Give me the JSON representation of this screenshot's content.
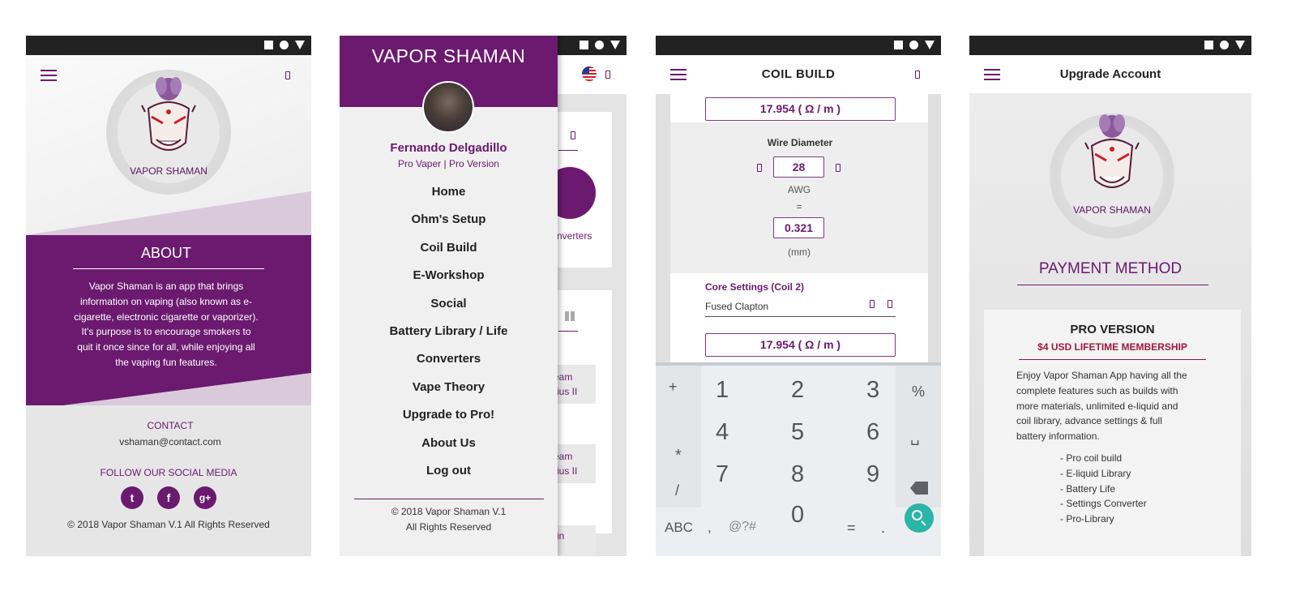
{
  "about_screen": {
    "logo_text": "VAPOR SHAMAN",
    "heading": "ABOUT",
    "body_lines": [
      "Vapor Shaman is an app that brings",
      "information on vaping (also known as e-",
      "cigarette, electronic cigarette or vaporizer).",
      "It's purpose is to encourage smokers to",
      "quit it once since for all, while enjoying all",
      "the vaping fun features."
    ],
    "contact_label": "CONTACT",
    "contact_email": "vshaman@contact.com",
    "social_label": "FOLLOW OUR SOCIAL MEDIA",
    "social": [
      "twitter-icon",
      "facebook-icon",
      "google-plus-icon"
    ],
    "social_glyphs": [
      "t",
      "f",
      "g+"
    ],
    "copyright": "© 2018 Vapor Shaman V.1  All Rights Reserved"
  },
  "menu_screen": {
    "app_name": "VAPOR SHAMAN",
    "user_name": "Fernando Delgadillo",
    "user_role": "Pro Vaper | Pro Version",
    "items": [
      "Home",
      "Ohm's Setup",
      "Coil Build",
      "E-Workshop",
      "Social",
      "Battery Library / Life",
      "Converters",
      "Vape Theory",
      "Upgrade to Pro!",
      "About Us",
      "Log out"
    ],
    "footer_line1": "© 2018 Vapor Shaman V.1",
    "footer_line2": "All Rights Reserved",
    "bg_peek": {
      "converters_label": "nverters",
      "card1_line1": "eam",
      "card1_line2": "rius II",
      "card2_line1": "eam",
      "card2_line2": "rius II",
      "card3_line1": "in"
    }
  },
  "coil_screen": {
    "title": "COIL BUILD",
    "top_value": "17.954 ( Ω / m )",
    "wire_diameter_label": "Wire Diameter",
    "awg_value": "28",
    "awg_label": "AWG",
    "equals": "=",
    "mm_value": "0.321",
    "mm_label": "(mm)",
    "core_settings_label": "Core Settings (Coil 2)",
    "core_type": "Fused Clapton",
    "bottom_value": "17.954 ( Ω / m )",
    "keypad": {
      "left": [
        "+",
        "*",
        "/"
      ],
      "digits": [
        [
          "1",
          "2",
          "3"
        ],
        [
          "4",
          "5",
          "6"
        ],
        [
          "7",
          "8",
          "9"
        ]
      ],
      "zero": "0",
      "right": [
        "%",
        "␣"
      ],
      "bottom_row": [
        "ABC",
        ",",
        "@?#",
        "=",
        "."
      ]
    }
  },
  "upgrade_screen": {
    "title": "Upgrade Account",
    "logo_text": "VAPOR SHAMAN",
    "section_title": "PAYMENT METHOD",
    "plan_title": "PRO VERSION",
    "plan_price": "$4 USD LIFETIME MEMBERSHIP",
    "description_lines": [
      "Enjoy Vapor Shaman App having all the",
      "complete features such as builds with",
      "more materials, unlimited e-liquid and",
      "coil library, advance settings & full",
      "battery information."
    ],
    "features": [
      "- Pro coil build",
      "- E-liquid Library",
      "- Battery Life",
      "- Settings Converter",
      "- Pro-Library"
    ]
  },
  "colors": {
    "brand_purple": "#6b1a6f",
    "teal_fab": "#2bb5a8"
  }
}
